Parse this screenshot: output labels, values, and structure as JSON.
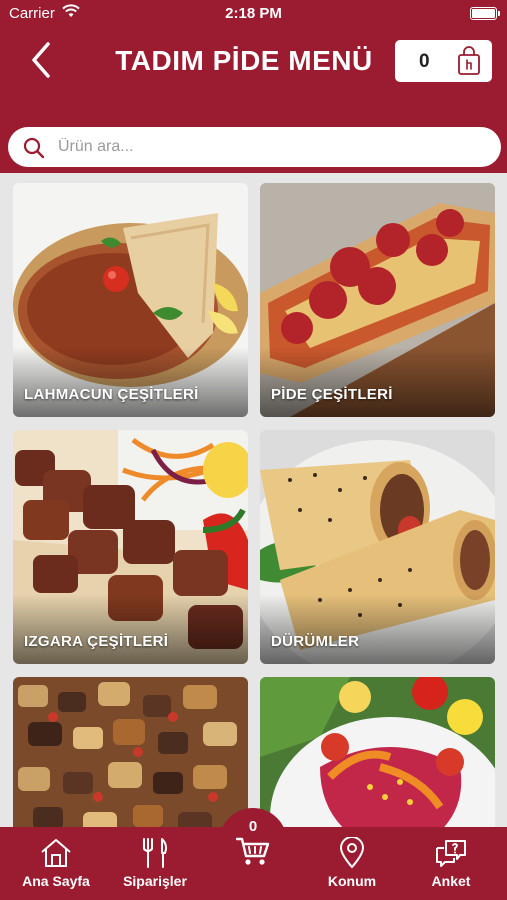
{
  "status_bar": {
    "carrier": "Carrier",
    "time": "2:18 PM"
  },
  "header": {
    "title": "TADIM PİDE MENÜ",
    "cart_count": "0"
  },
  "search": {
    "placeholder": "Ürün ara..."
  },
  "categories": [
    {
      "label": "LAHMACUN ÇEŞİTLERİ"
    },
    {
      "label": "PİDE ÇEŞİTLERİ"
    },
    {
      "label": "IZGARA ÇEŞİTLERİ"
    },
    {
      "label": "DÜRÜMLER"
    },
    {
      "label": ""
    },
    {
      "label": ""
    }
  ],
  "bottom_nav": {
    "home": "Ana Sayfa",
    "orders": "Siparişler",
    "cart_count": "0",
    "location": "Konum",
    "survey": "Anket"
  },
  "colors": {
    "brand": "#9b1b30",
    "background": "#e6e6e6"
  },
  "icons": [
    "wifi-icon",
    "battery-icon",
    "back-chevron-icon",
    "shopping-bag-icon",
    "search-icon",
    "home-icon",
    "fork-knife-icon",
    "cart-icon",
    "location-pin-icon",
    "survey-chat-icon"
  ]
}
